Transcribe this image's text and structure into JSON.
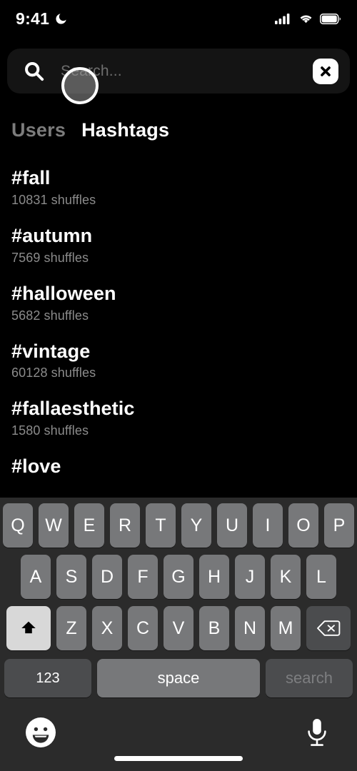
{
  "status_bar": {
    "time": "9:41",
    "dnd_icon": "crescent-moon-icon",
    "cellular_icon": "cellular-signal-icon",
    "wifi_icon": "wifi-icon",
    "battery_icon": "battery-full-icon"
  },
  "search": {
    "icon": "search-icon",
    "placeholder": "Search...",
    "value": "",
    "clear_icon": "close-x-icon"
  },
  "tabs": [
    {
      "label": "Users",
      "active": false
    },
    {
      "label": "Hashtags",
      "active": true
    }
  ],
  "hashtags": [
    {
      "tag": "#fall",
      "count": "10831 shuffles"
    },
    {
      "tag": "#autumn",
      "count": "7569 shuffles"
    },
    {
      "tag": "#halloween",
      "count": "5682 shuffles"
    },
    {
      "tag": "#vintage",
      "count": "60128 shuffles"
    },
    {
      "tag": "#fallaesthetic",
      "count": "1580 shuffles"
    },
    {
      "tag": "#love",
      "count": ""
    }
  ],
  "keyboard": {
    "row1": [
      "Q",
      "W",
      "E",
      "R",
      "T",
      "Y",
      "U",
      "I",
      "O",
      "P"
    ],
    "row2": [
      "A",
      "S",
      "D",
      "F",
      "G",
      "H",
      "J",
      "K",
      "L"
    ],
    "row3": [
      "Z",
      "X",
      "C",
      "V",
      "B",
      "N",
      "M"
    ],
    "shift_icon": "shift-arrow-icon",
    "backspace_icon": "backspace-icon",
    "numbers_label": "123",
    "space_label": "space",
    "return_label": "search",
    "emoji_icon": "emoji-smiley-icon",
    "mic_icon": "microphone-icon"
  },
  "colors": {
    "background": "#000000",
    "keyboard_bg": "#2b2b2b",
    "key": "#77787a",
    "key_dark": "#4b4c4e",
    "key_active": "#d8d8d8",
    "accent_text": "#ffffff",
    "muted_text": "#8b8b8b"
  }
}
